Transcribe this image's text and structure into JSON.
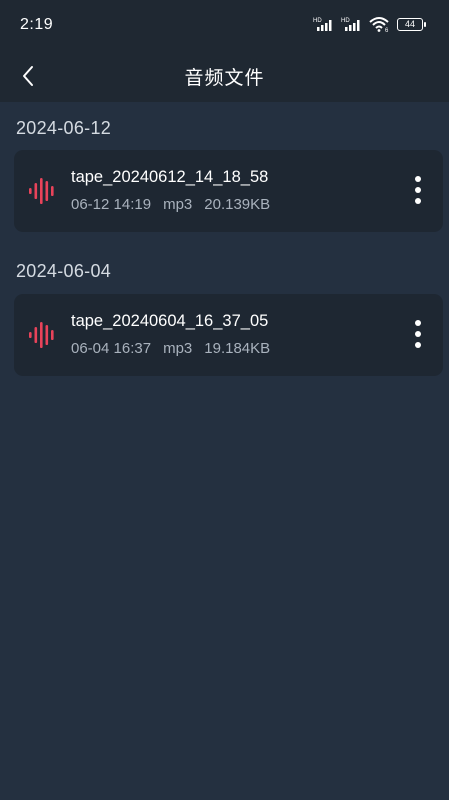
{
  "status_bar": {
    "time": "2:19",
    "signal_1_label": "HD",
    "signal_2_label": "HD",
    "wifi_sub": "6",
    "battery": "44"
  },
  "header": {
    "title": "音频文件",
    "back_icon": "chevron-left-icon"
  },
  "groups": [
    {
      "date": "2024-06-12",
      "files": [
        {
          "name": "tape_20240612_14_18_58",
          "time": "06-12 14:19",
          "format": "mp3",
          "size": "20.139KB",
          "icon": "audio-wave-icon"
        }
      ]
    },
    {
      "date": "2024-06-04",
      "files": [
        {
          "name": "tape_20240604_16_37_05",
          "time": "06-04 16:37",
          "format": "mp3",
          "size": "19.184KB",
          "icon": "audio-wave-icon"
        }
      ]
    }
  ],
  "colors": {
    "background": "#243040",
    "header": "#1f2832",
    "card": "#1e2732",
    "accent": "#e8435a",
    "meta_text": "#a9b2bd"
  }
}
